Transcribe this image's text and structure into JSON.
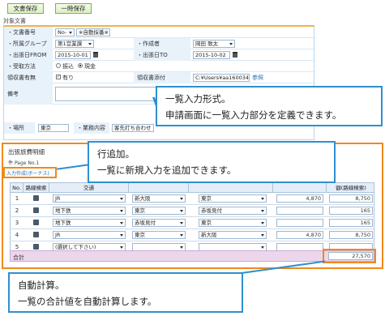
{
  "toolbar": {
    "save_label": "文書保存",
    "temp_save_label": "一時保存"
  },
  "section_target": "対象文書",
  "form": {
    "doc_number_label": "・文書番号",
    "doc_number_select": "No-",
    "doc_number_value": "※自動採番※",
    "dept_label": "・所属グループ",
    "dept_value": "第1営業課",
    "author_label": "・作成者",
    "author_value": "岡田 歌太",
    "trip_from_label": "・出張日FROM",
    "trip_from_value": "2015-10-01",
    "trip_to_label": "・出張日TO",
    "trip_to_value": "2015-10-02",
    "pay_method_label": "・受取方法",
    "pay_option_1": "振込",
    "pay_option_2": "現金",
    "receipt_label": "領収書有無",
    "receipt_value": "有り",
    "receipt_attach_label": "領収書添付",
    "receipt_attach_value": "C:¥Users¥aa160034",
    "browse_label": "参照",
    "note_label": "備考",
    "place_label": "・場所",
    "place_value": "東京",
    "purpose_label": "・業務内容",
    "purpose_value": "客先打ち合わせ"
  },
  "callouts": {
    "c1_line1": "一覧入力形式。",
    "c1_line2": "申請画面に一覧入力部分を定義できます。",
    "c2_line1": "行追加。",
    "c2_line2": "一覧に新規入力を追加できます。",
    "c3_line1": "自動計算。",
    "c3_line2": "一覧の合計値を自動計算します。"
  },
  "list": {
    "title": "出張旅費明細",
    "page_label": "Page No.1",
    "page_prefix": "件",
    "add_row_label": "入力作成(ボーナス)",
    "headers": [
      "No.",
      "路線検索",
      "交通",
      "",
      "",
      "",
      "",
      "額(路線検索)"
    ],
    "rows": [
      {
        "no": "1",
        "transport": "JR",
        "from": "新大阪",
        "to": "東京",
        "fare": "4,870",
        "total": "8,750"
      },
      {
        "no": "2",
        "transport": "地下鉄",
        "from": "東京",
        "to": "赤坂見付",
        "fare": "",
        "total": "165"
      },
      {
        "no": "3",
        "transport": "地下鉄",
        "from": "赤坂見付",
        "to": "東京",
        "fare": "",
        "total": "165"
      },
      {
        "no": "4",
        "transport": "JR",
        "from": "東京",
        "to": "新大阪",
        "fare": "4,870",
        "total": "8,750"
      },
      {
        "no": "5",
        "transport": "(選択して下さい)",
        "from": "",
        "to": "",
        "fare": "",
        "total": ""
      }
    ],
    "total_label": "合計",
    "total_value": "27,570"
  }
}
